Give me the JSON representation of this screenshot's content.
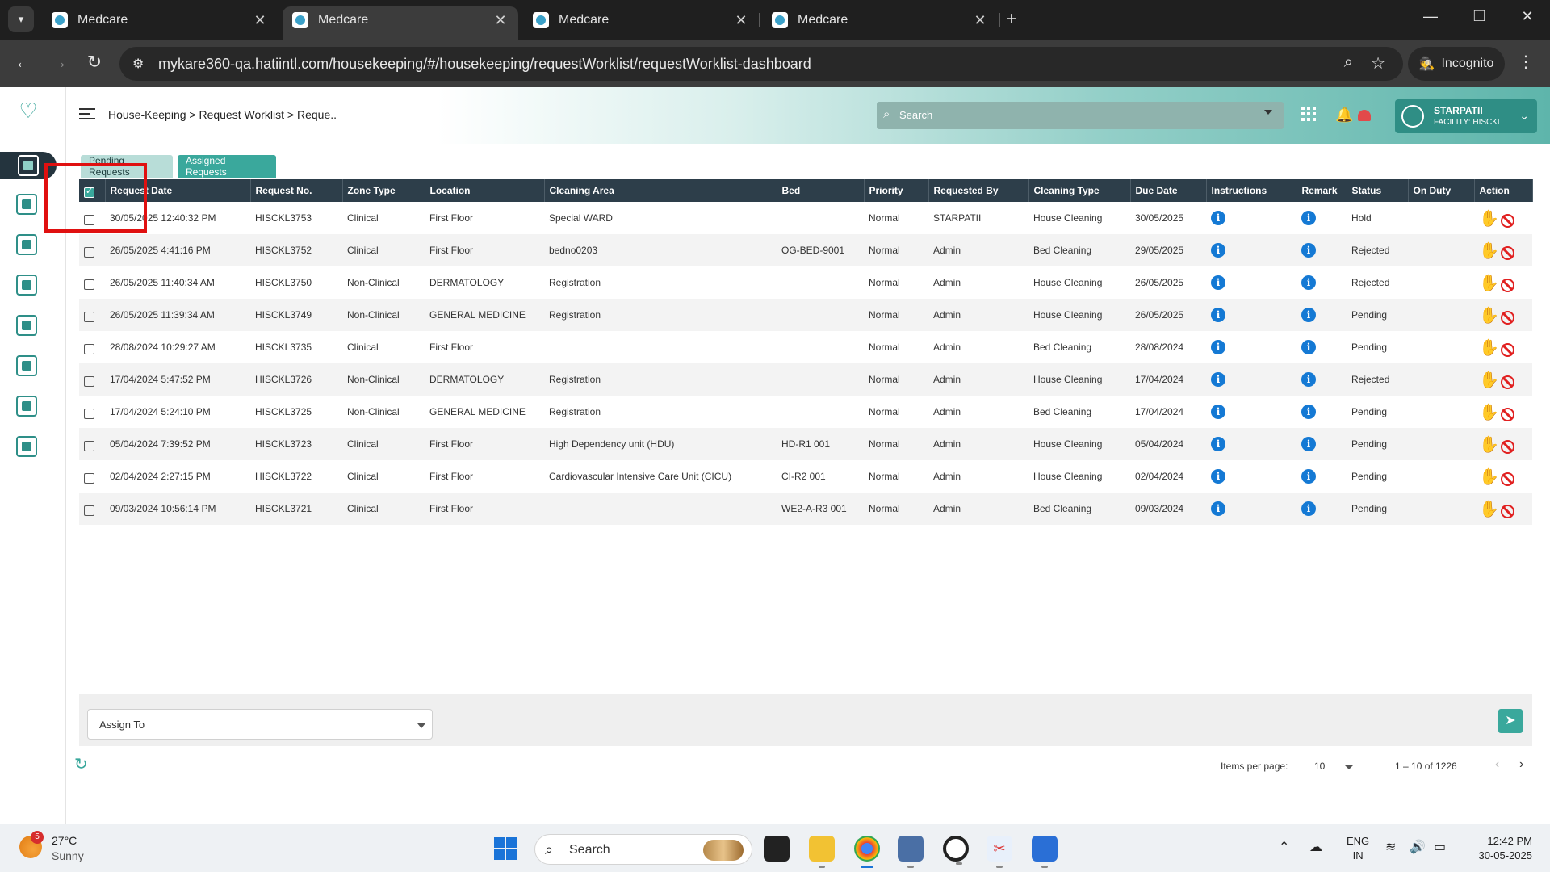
{
  "browser": {
    "tabs": [
      {
        "label": "Medcare"
      },
      {
        "label": "Medcare"
      },
      {
        "label": "Medcare"
      },
      {
        "label": "Medcare"
      }
    ],
    "url": "mykare360-qa.hatiintl.com/housekeeping/#/housekeeping/requestWorklist/requestWorklist-dashboard",
    "incognito_label": "Incognito"
  },
  "header": {
    "breadcrumb": "House-Keeping > Request Worklist > Reque..",
    "search_placeholder": "Search",
    "user_name": "STARPATII",
    "facility": "FACILITY: HISCKL"
  },
  "request_tabs": {
    "pending": "Pending Requests",
    "assigned": "Assigned Requests"
  },
  "table": {
    "columns": [
      "Request Date",
      "Request No.",
      "Zone Type",
      "Location",
      "Cleaning Area",
      "Bed",
      "Priority",
      "Requested By",
      "Cleaning Type",
      "Due Date",
      "Instructions",
      "Remark",
      "Status",
      "On Duty",
      "Action"
    ],
    "rows": [
      {
        "date": "30/05/2025 12:40:32 PM",
        "no": "HISCKL3753",
        "zone": "Clinical",
        "location": "First Floor",
        "area": "Special WARD",
        "bed": "",
        "priority": "Normal",
        "by": "STARPATII",
        "type": "House Cleaning",
        "due": "30/05/2025",
        "status": "Hold",
        "on_duty": "",
        "hand_active": true
      },
      {
        "date": "26/05/2025 4:41:16 PM",
        "no": "HISCKL3752",
        "zone": "Clinical",
        "location": "First Floor",
        "area": "bedno0203",
        "bed": "OG-BED-9001",
        "priority": "Normal",
        "by": "Admin",
        "type": "Bed Cleaning",
        "due": "29/05/2025",
        "status": "Rejected",
        "on_duty": "",
        "hand_active": false
      },
      {
        "date": "26/05/2025 11:40:34 AM",
        "no": "HISCKL3750",
        "zone": "Non-Clinical",
        "location": "DERMATOLOGY",
        "area": "Registration",
        "bed": "",
        "priority": "Normal",
        "by": "Admin",
        "type": "House Cleaning",
        "due": "26/05/2025",
        "status": "Rejected",
        "on_duty": "",
        "hand_active": false
      },
      {
        "date": "26/05/2025 11:39:34 AM",
        "no": "HISCKL3749",
        "zone": "Non-Clinical",
        "location": "GENERAL MEDICINE",
        "area": "Registration",
        "bed": "",
        "priority": "Normal",
        "by": "Admin",
        "type": "House Cleaning",
        "due": "26/05/2025",
        "status": "Pending",
        "on_duty": "",
        "hand_active": false
      },
      {
        "date": "28/08/2024 10:29:27 AM",
        "no": "HISCKL3735",
        "zone": "Clinical",
        "location": "First Floor",
        "area": "",
        "bed": "",
        "priority": "Normal",
        "by": "Admin",
        "type": "Bed Cleaning",
        "due": "28/08/2024",
        "status": "Pending",
        "on_duty": "",
        "hand_active": false
      },
      {
        "date": "17/04/2024 5:47:52 PM",
        "no": "HISCKL3726",
        "zone": "Non-Clinical",
        "location": "DERMATOLOGY",
        "area": "Registration",
        "bed": "",
        "priority": "Normal",
        "by": "Admin",
        "type": "House Cleaning",
        "due": "17/04/2024",
        "status": "Rejected",
        "on_duty": "",
        "hand_active": false
      },
      {
        "date": "17/04/2024 5:24:10 PM",
        "no": "HISCKL3725",
        "zone": "Non-Clinical",
        "location": "GENERAL MEDICINE",
        "area": "Registration",
        "bed": "",
        "priority": "Normal",
        "by": "Admin",
        "type": "Bed Cleaning",
        "due": "17/04/2024",
        "status": "Pending",
        "on_duty": "",
        "hand_active": false
      },
      {
        "date": "05/04/2024 7:39:52 PM",
        "no": "HISCKL3723",
        "zone": "Clinical",
        "location": "First Floor",
        "area": "High Dependency unit (HDU)",
        "bed": "HD-R1 001",
        "priority": "Normal",
        "by": "Admin",
        "type": "House Cleaning",
        "due": "05/04/2024",
        "status": "Pending",
        "on_duty": "",
        "hand_active": false
      },
      {
        "date": "02/04/2024 2:27:15 PM",
        "no": "HISCKL3722",
        "zone": "Clinical",
        "location": "First Floor",
        "area": "Cardiovascular Intensive Care Unit (CICU)",
        "bed": "CI-R2 001",
        "priority": "Normal",
        "by": "Admin",
        "type": "House Cleaning",
        "due": "02/04/2024",
        "status": "Pending",
        "on_duty": "",
        "hand_active": false
      },
      {
        "date": "09/03/2024 10:56:14 PM",
        "no": "HISCKL3721",
        "zone": "Clinical",
        "location": "First Floor",
        "area": "",
        "bed": "WE2-A-R3 001",
        "priority": "Normal",
        "by": "Admin",
        "type": "Bed Cleaning",
        "due": "09/03/2024",
        "status": "Pending",
        "on_duty": "",
        "hand_active": false
      }
    ]
  },
  "assign": {
    "label": "Assign To"
  },
  "paginator": {
    "items_per_page_label": "Items per page:",
    "items_per_page": "10",
    "range": "1 – 10 of 1226"
  },
  "taskbar": {
    "weather_badge": "5",
    "temperature": "27°C",
    "weather": "Sunny",
    "search": "Search",
    "lang_top": "ENG",
    "lang_bottom": "IN",
    "time": "12:42 PM",
    "date": "30-05-2025"
  },
  "colors": {
    "accent": "#3aa89c",
    "table_header": "#2d3e4a",
    "info_blue": "#1479d4",
    "danger": "#e12020"
  }
}
